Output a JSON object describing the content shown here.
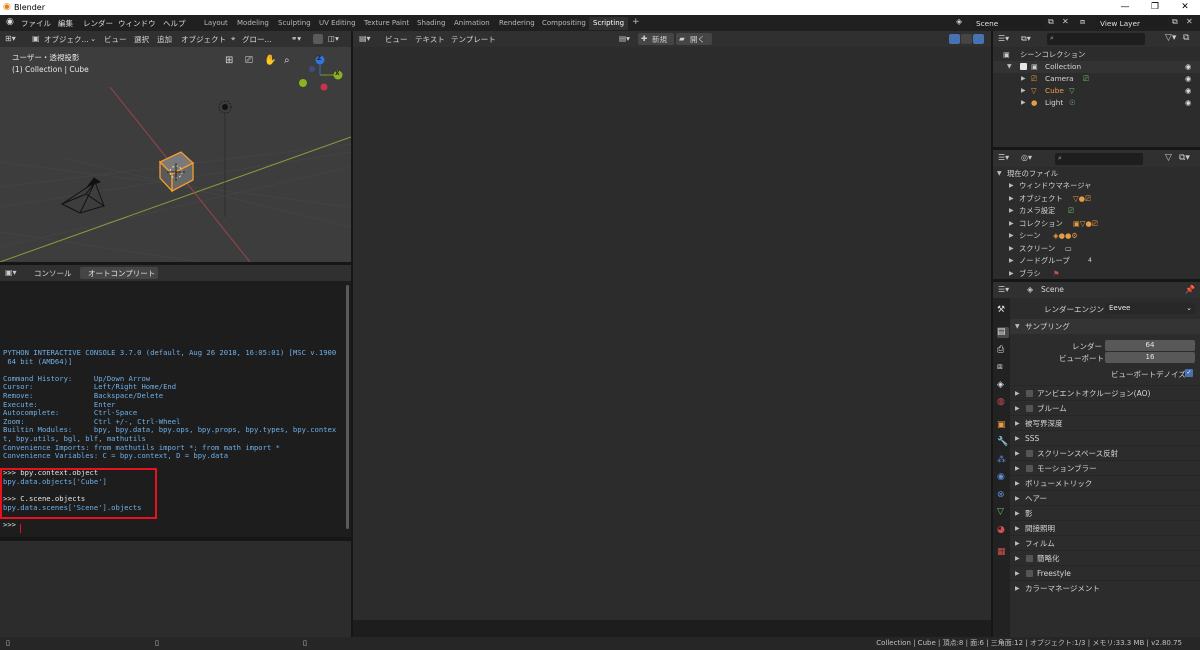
{
  "window": {
    "title": "Blender",
    "controls": [
      "—",
      "❐",
      "✕"
    ]
  },
  "menu": [
    "ファイル",
    "編集",
    "レンダー",
    "ウィンドウ",
    "ヘルプ"
  ],
  "workspaces": [
    "Layout",
    "Modeling",
    "Sculpting",
    "UV Editing",
    "Texture Paint",
    "Shading",
    "Animation",
    "Rendering",
    "Compositing",
    "Scripting"
  ],
  "active_workspace": "Scripting",
  "scene_name": "Scene",
  "view_layer": "View Layer",
  "viewport": {
    "header": [
      "オブジェク...",
      "ビュー",
      "選択",
      "追加",
      "オブジェクト",
      "グロー..."
    ],
    "overlay_line1": "ユーザー・透視投影",
    "overlay_line2": "(1) Collection | Cube",
    "gizmo": {
      "x": "X",
      "y": "Y",
      "z": "Z"
    }
  },
  "console": {
    "tabs": [
      "コンソール",
      "オートコンプリート"
    ],
    "lines": [
      {
        "t": "out",
        "s": "PYTHON INTERACTIVE CONSOLE 3.7.0 (default, Aug 26 2018, 16:05:01) [MSC v.1900"
      },
      {
        "t": "out",
        "s": " 64 bit (AMD64)]"
      },
      {
        "t": "out",
        "s": ""
      },
      {
        "t": "out",
        "s": "Command History:     Up/Down Arrow"
      },
      {
        "t": "out",
        "s": "Cursor:              Left/Right Home/End"
      },
      {
        "t": "out",
        "s": "Remove:              Backspace/Delete"
      },
      {
        "t": "out",
        "s": "Execute:             Enter"
      },
      {
        "t": "out",
        "s": "Autocomplete:        Ctrl-Space"
      },
      {
        "t": "out",
        "s": "Zoom:                Ctrl +/-, Ctrl-Wheel"
      },
      {
        "t": "out",
        "s": "Builtin Modules:     bpy, bpy.data, bpy.ops, bpy.props, bpy.types, bpy.contex"
      },
      {
        "t": "out",
        "s": "t, bpy.utils, bgl, blf, mathutils"
      },
      {
        "t": "out",
        "s": "Convenience Imports: from mathutils import *; from math import *"
      },
      {
        "t": "out",
        "s": "Convenience Variables: C = bpy.context, D = bpy.data"
      },
      {
        "t": "out",
        "s": ""
      },
      {
        "t": "in",
        "s": ">>> bpy.context.object"
      },
      {
        "t": "out",
        "s": "bpy.data.objects['Cube']"
      },
      {
        "t": "out",
        "s": ""
      },
      {
        "t": "in",
        "s": ">>> C.scene.objects"
      },
      {
        "t": "out",
        "s": "bpy.data.scenes['Scene'].objects"
      },
      {
        "t": "out",
        "s": ""
      },
      {
        "t": "in",
        "s": ">>> "
      }
    ]
  },
  "text_editor": {
    "header": [
      "ビュー",
      "テキスト",
      "テンプレート"
    ],
    "new_label": "新規",
    "open_label": "開く"
  },
  "outliner": {
    "root": "シーンコレクション",
    "collection": "Collection",
    "items": [
      "Camera",
      "Cube",
      "Light"
    ]
  },
  "file_browser": {
    "root": "現在のファイル",
    "items": [
      "ウィンドウマネージャ",
      "オブジェクト",
      "カメラ設定",
      "コレクション",
      "シーン",
      "スクリーン",
      "ノードグループ",
      "ブラシ"
    ],
    "node_group_count": "4"
  },
  "properties": {
    "scene": "Scene",
    "render_engine_label": "レンダーエンジン",
    "render_engine": "Eevee",
    "sampling_label": "サンプリング",
    "render_label": "レンダー",
    "render_samples": "64",
    "viewport_label": "ビューポート",
    "viewport_samples": "16",
    "viewport_denoise": "ビューポートデノイズ",
    "panels": [
      {
        "label": "アンビエントオクルージョン(AO)",
        "checkbox": true
      },
      {
        "label": "ブルーム",
        "checkbox": true
      },
      {
        "label": "被写界深度",
        "checkbox": false
      },
      {
        "label": "SSS",
        "checkbox": false
      },
      {
        "label": "スクリーンスペース反射",
        "checkbox": true
      },
      {
        "label": "モーションブラー",
        "checkbox": true
      },
      {
        "label": "ボリューメトリック",
        "checkbox": false
      },
      {
        "label": "ヘアー",
        "checkbox": false
      },
      {
        "label": "影",
        "checkbox": false
      },
      {
        "label": "間接照明",
        "checkbox": false
      },
      {
        "label": "フィルム",
        "checkbox": false
      },
      {
        "label": "簡略化",
        "checkbox": true
      },
      {
        "label": "Freestyle",
        "checkbox": true
      },
      {
        "label": "カラーマネージメント",
        "checkbox": false
      }
    ]
  },
  "status_bar": "Collection | Cube | 頂点:8 | 面:6 | 三角面:12 | オブジェクト:1/3 | メモリ:33.3 MB | v2.80.75",
  "colors": {
    "accent": "#4772b3",
    "active_object": "#e89b43",
    "highlight_box": "#e8121f",
    "console_output": "#6fb0e8"
  }
}
